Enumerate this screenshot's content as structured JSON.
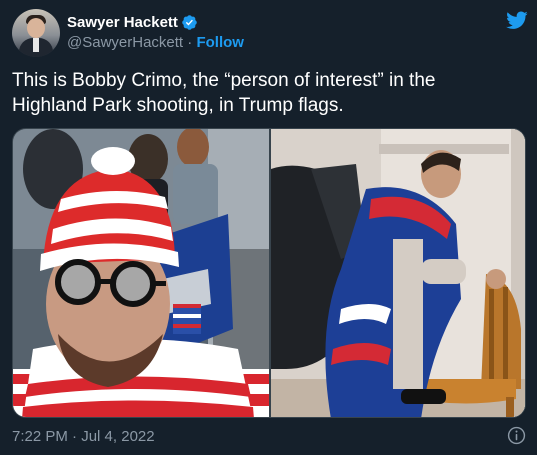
{
  "author": {
    "name": "Sawyer Hackett",
    "handle": "@SawyerHackett",
    "separator": "·",
    "follow_label": "Follow"
  },
  "tweet": {
    "text": "This is Bobby Crimo, the “person of interest” in the Highland Park shooting, in Trump flags."
  },
  "media": {
    "photos": [
      {
        "description_icon": "photo-icon"
      },
      {
        "description_icon": "photo-icon"
      }
    ]
  },
  "meta": {
    "time": "7:22 PM",
    "separator": "·",
    "date": "Jul 4, 2022"
  },
  "icons": {
    "verified": "verified-badge-icon",
    "brand": "twitter-bird-icon",
    "info": "info-icon"
  },
  "colors": {
    "background": "#15202b",
    "accent": "#1d9bf0",
    "secondary_text": "#8b98a5",
    "border": "#38444d"
  }
}
